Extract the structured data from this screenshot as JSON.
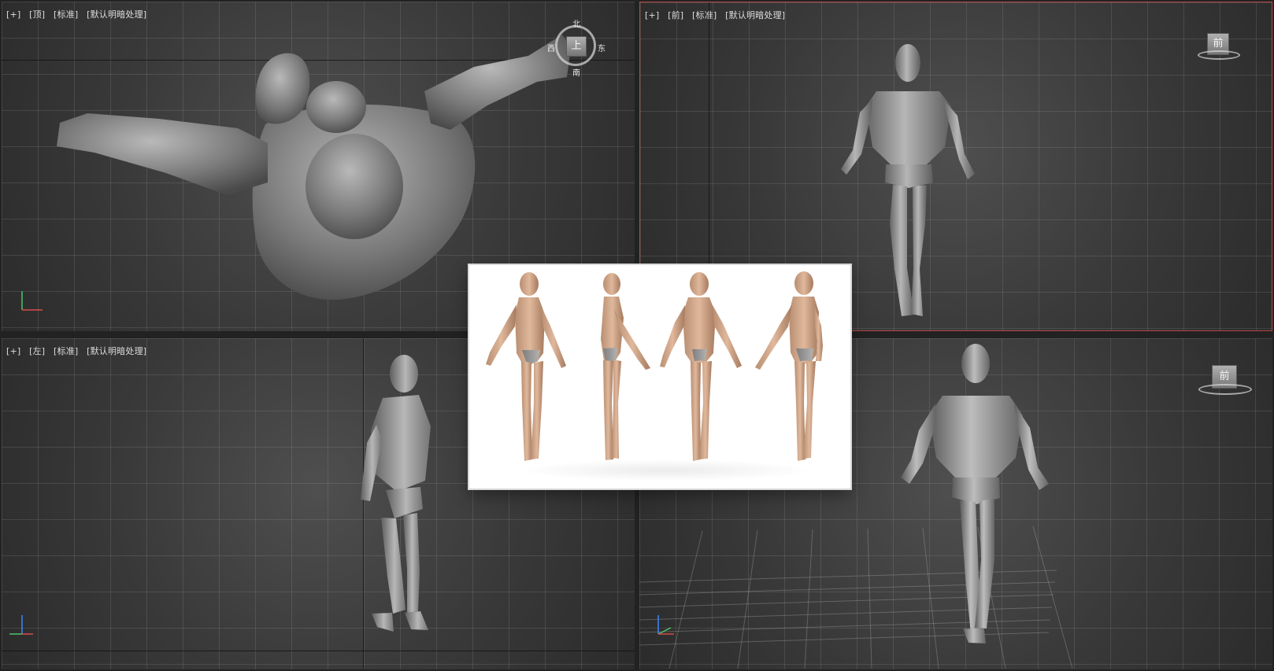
{
  "app": {
    "viewports": [
      {
        "id": "top",
        "labels": [
          "[+]",
          "[顶]",
          "[标准]",
          "[默认明暗处理]"
        ],
        "active": false
      },
      {
        "id": "front",
        "labels": [
          "[+]",
          "[前]",
          "[标准]",
          "[默认明暗处理]"
        ],
        "active": true
      },
      {
        "id": "left",
        "labels": [
          "[+]",
          "[左]",
          "[标准]",
          "[默认明暗处理]"
        ],
        "active": false
      },
      {
        "id": "perspective",
        "labels": [],
        "active": false
      }
    ]
  },
  "navcube": {
    "top_view": {
      "face": "上",
      "north": "北",
      "east": "东",
      "south": "南",
      "west": "西"
    },
    "front_view": {
      "face": "前"
    },
    "perspective_view": {
      "face": "前"
    }
  },
  "reference_image": {
    "figures": [
      "front-three-quarter",
      "side",
      "back",
      "back-three-quarter"
    ]
  },
  "colors": {
    "viewport_bg": "#3d3d3d",
    "grid": "#8a8a8a",
    "active_border": "#b84646",
    "model": "#8d8d8d"
  },
  "icons": {
    "viewport_label": "text-bracket-labels",
    "navcube": "navigation-cube-icon",
    "axis_tripod": "axis-tripod-icon",
    "reference": "reference-image"
  }
}
